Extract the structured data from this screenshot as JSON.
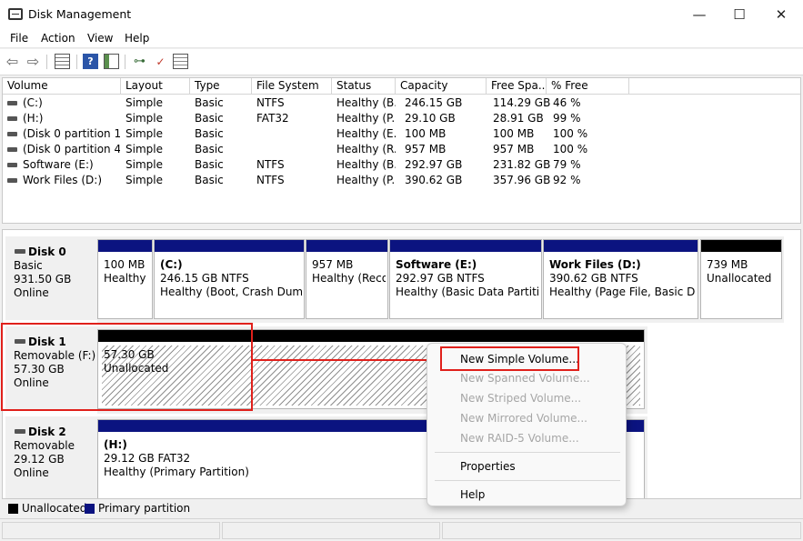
{
  "window": {
    "title": "Disk Management",
    "controls": {
      "minimize": "—",
      "maximize": "☐",
      "close": "✕"
    }
  },
  "menu": [
    "File",
    "Action",
    "View",
    "Help"
  ],
  "toolbar": {
    "icons": [
      "back-arrow-icon",
      "forward-arrow-icon",
      "grid-view-icon",
      "help-icon",
      "panel-icon",
      "connect-icon",
      "check-icon",
      "list-view-icon"
    ],
    "glyphs": {
      "back": "⇦",
      "forward": "⇨",
      "help": "?",
      "connect": "⊶",
      "check": "✓"
    }
  },
  "volume_table": {
    "columns": [
      "Volume",
      "Layout",
      "Type",
      "File System",
      "Status",
      "Capacity",
      "Free Spa...",
      "% Free"
    ],
    "rows": [
      [
        "(C:)",
        "Simple",
        "Basic",
        "NTFS",
        "Healthy (B...",
        "246.15 GB",
        "114.29 GB",
        "46 %"
      ],
      [
        "(H:)",
        "Simple",
        "Basic",
        "FAT32",
        "Healthy (P...",
        "29.10 GB",
        "28.91 GB",
        "99 %"
      ],
      [
        "(Disk 0 partition 1)",
        "Simple",
        "Basic",
        "",
        "Healthy (E...",
        "100 MB",
        "100 MB",
        "100 %"
      ],
      [
        "(Disk 0 partition 4)",
        "Simple",
        "Basic",
        "",
        "Healthy (R...",
        "957 MB",
        "957 MB",
        "100 %"
      ],
      [
        "Software (E:)",
        "Simple",
        "Basic",
        "NTFS",
        "Healthy (B...",
        "292.97 GB",
        "231.82 GB",
        "79 %"
      ],
      [
        "Work Files (D:)",
        "Simple",
        "Basic",
        "NTFS",
        "Healthy (P...",
        "390.62 GB",
        "357.96 GB",
        "92 %"
      ]
    ]
  },
  "disks": [
    {
      "name": "Disk 0",
      "type": "Basic",
      "size": "931.50 GB",
      "status": "Online",
      "partitions": [
        {
          "name": "",
          "line1": "100 MB",
          "line2": "Healthy (",
          "kind": "primary"
        },
        {
          "name": "(C:)",
          "line1": "246.15 GB NTFS",
          "line2": "Healthy (Boot, Crash Dump,",
          "kind": "primary"
        },
        {
          "name": "",
          "line1": "957 MB",
          "line2": "Healthy (Reco",
          "kind": "primary"
        },
        {
          "name": "Software  (E:)",
          "line1": "292.97 GB NTFS",
          "line2": "Healthy (Basic Data Partition)",
          "kind": "primary"
        },
        {
          "name": "Work Files  (D:)",
          "line1": "390.62 GB NTFS",
          "line2": "Healthy (Page File, Basic Data",
          "kind": "primary"
        },
        {
          "name": "",
          "line1": "739 MB",
          "line2": "Unallocated",
          "kind": "unallocated"
        }
      ]
    },
    {
      "name": "Disk 1",
      "type": "Removable (F:)",
      "size": "57.30 GB",
      "status": "Online",
      "partitions": [
        {
          "name": "",
          "line1": "57.30 GB",
          "line2": "Unallocated",
          "kind": "unallocated"
        }
      ]
    },
    {
      "name": "Disk 2",
      "type": "Removable",
      "size": "29.12 GB",
      "status": "Online",
      "partitions": [
        {
          "name": "(H:)",
          "line1": "29.12 GB FAT32",
          "line2": "Healthy (Primary Partition)",
          "kind": "primary"
        }
      ]
    }
  ],
  "legend": [
    {
      "label": "Unallocated",
      "color": "#000000"
    },
    {
      "label": "Primary partition",
      "color": "#0b1380"
    }
  ],
  "context_menu": {
    "items": [
      {
        "label": "New Simple Volume...",
        "enabled": true
      },
      {
        "label": "New Spanned Volume...",
        "enabled": false
      },
      {
        "label": "New Striped Volume...",
        "enabled": false
      },
      {
        "label": "New Mirrored Volume...",
        "enabled": false
      },
      {
        "label": "New RAID-5 Volume...",
        "enabled": false
      },
      {
        "label": "Properties",
        "enabled": true
      },
      {
        "label": "Help",
        "enabled": true
      }
    ]
  },
  "colors": {
    "highlight": "#e0201b",
    "primary_bar": "#0b1380",
    "unallocated_bar": "#000000"
  }
}
